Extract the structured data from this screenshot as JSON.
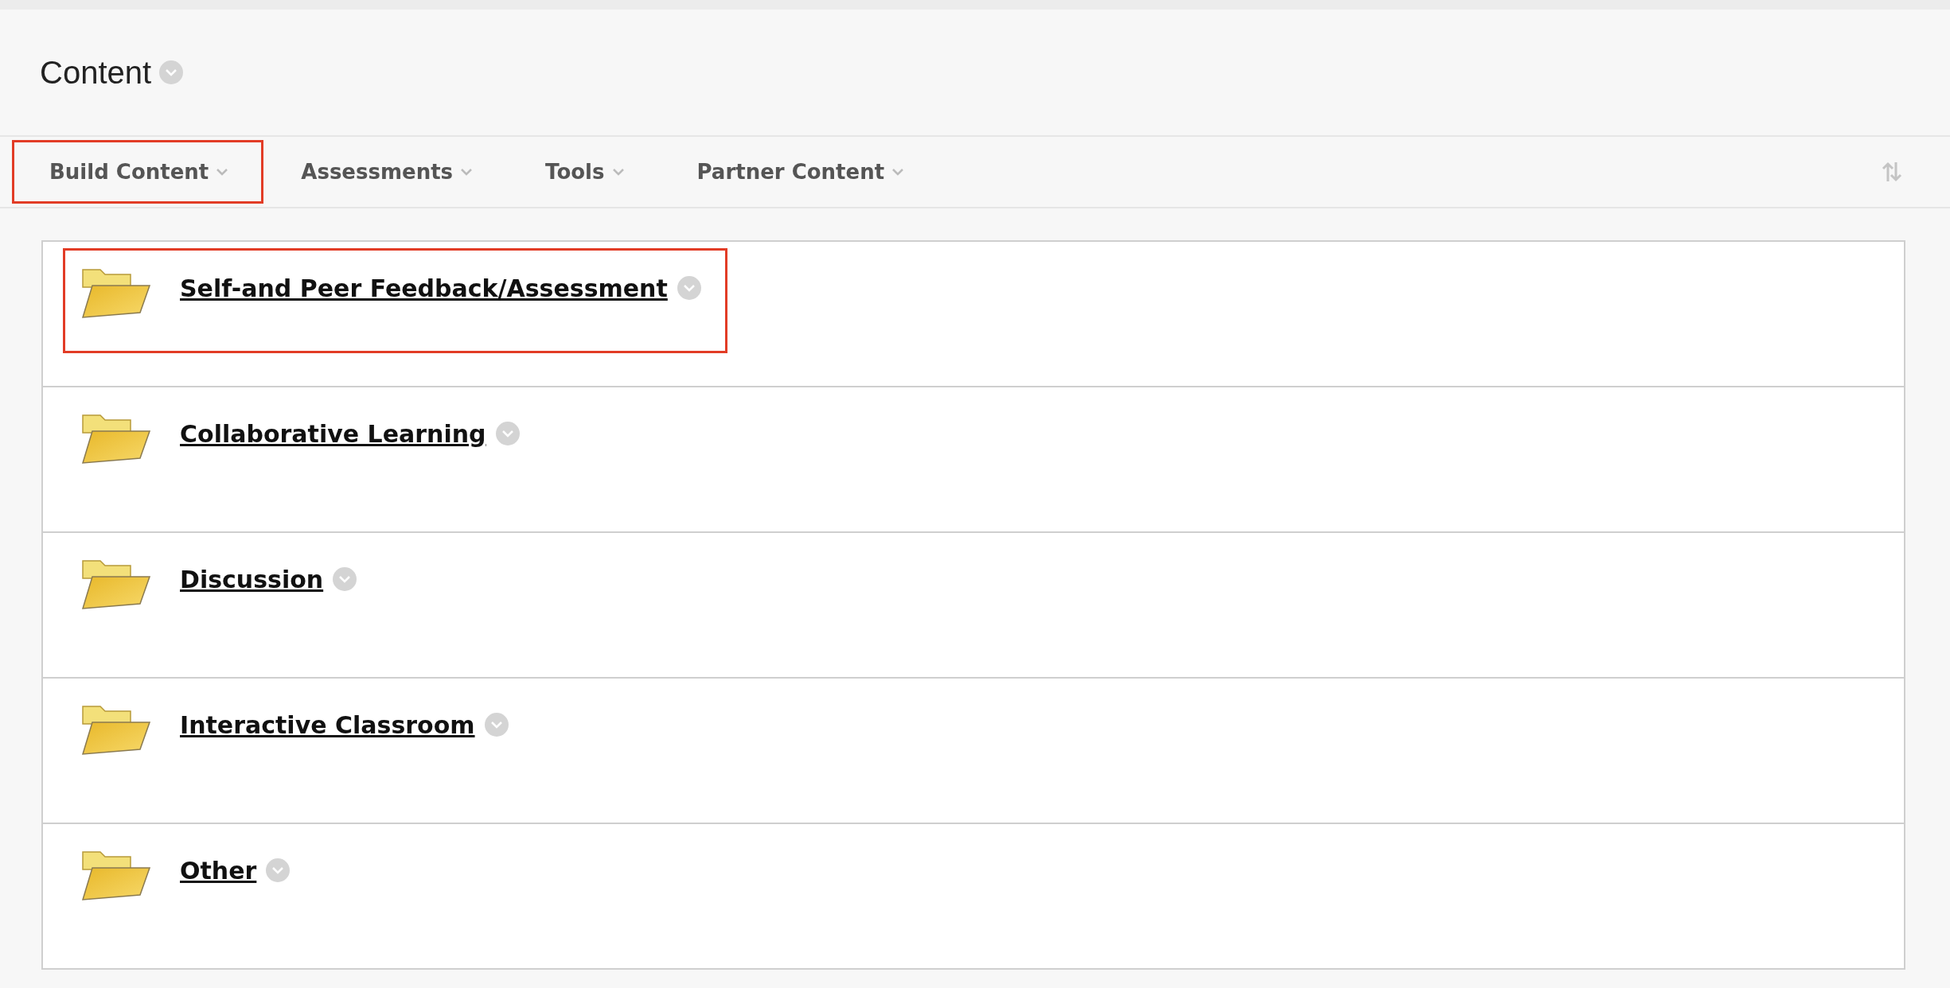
{
  "page": {
    "title": "Content"
  },
  "toolbar": {
    "items": [
      {
        "label": "Build Content",
        "highlighted": true
      },
      {
        "label": "Assessments",
        "highlighted": false
      },
      {
        "label": "Tools",
        "highlighted": false
      },
      {
        "label": "Partner Content",
        "highlighted": false
      }
    ]
  },
  "content_items": [
    {
      "title": "Self-and Peer Feedback/Assessment",
      "highlighted": true
    },
    {
      "title": "Collaborative Learning",
      "highlighted": false
    },
    {
      "title": "Discussion",
      "highlighted": false
    },
    {
      "title": "Interactive Classroom",
      "highlighted": false
    },
    {
      "title": "Other",
      "highlighted": false
    }
  ]
}
